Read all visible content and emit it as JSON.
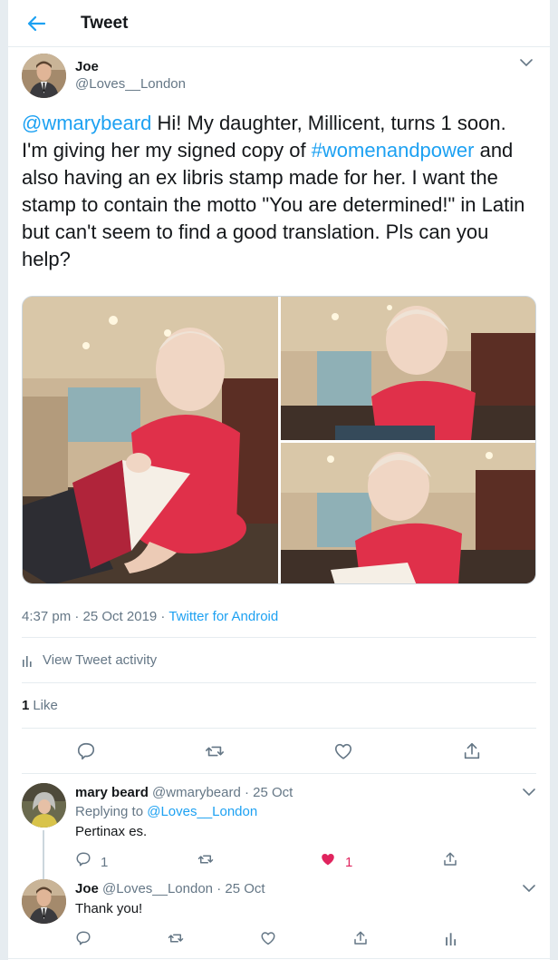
{
  "header": {
    "title": "Tweet"
  },
  "tweet": {
    "author_name": "Joe",
    "author_handle": "@Loves__London",
    "text_mention": "@wmarybeard",
    "text_part1": " Hi! My daughter, Millicent, turns 1 soon. I'm giving her my signed copy of ",
    "text_hashtag": "#womenandpower",
    "text_part2": " and also having an ex libris stamp made for her. I want the stamp to contain the motto \"You are determined!\" in Latin but can't seem to find a good translation. Pls can you help?",
    "time": "4:37 pm · 25 Oct 2019",
    "dot": " · ",
    "source": "Twitter for Android",
    "activity_label": "View Tweet activity",
    "likes_count": "1",
    "likes_label": "Like",
    "icons": [
      "back-arrow-icon",
      "chevron-down-icon",
      "bar-chart-icon",
      "reply-icon",
      "retweet-icon",
      "heart-icon",
      "share-icon"
    ]
  },
  "replies": [
    {
      "name": "mary beard",
      "handle": "@wmarybeard",
      "date": " · 25 Oct",
      "replying_label": "Replying to ",
      "replying_to": "@Loves__London",
      "text": "Pertinax es.",
      "reply_count": "1",
      "retweet_count": "",
      "like_count": "1"
    },
    {
      "name": "Joe",
      "handle": "@Loves__London",
      "date": " · 25 Oct",
      "text": "Thank you!"
    }
  ],
  "colors": {
    "accent": "#1da1f2",
    "like": "#e0245e",
    "muted": "#657786",
    "border": "#e6ecf0"
  }
}
